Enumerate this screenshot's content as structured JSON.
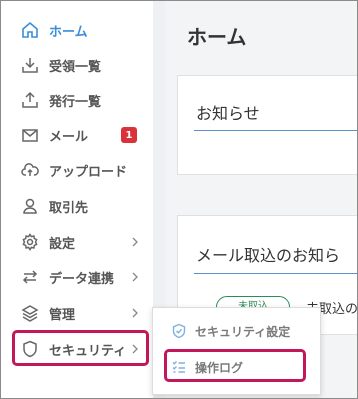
{
  "sidebar": {
    "items": [
      {
        "label": "ホーム",
        "icon": "home-icon"
      },
      {
        "label": "受領一覧",
        "icon": "download-tray-icon"
      },
      {
        "label": "発行一覧",
        "icon": "upload-tray-icon"
      },
      {
        "label": "メール",
        "icon": "envelope-icon",
        "badge": "1"
      },
      {
        "label": "アップロード",
        "icon": "cloud-upload-icon"
      },
      {
        "label": "取引先",
        "icon": "person-icon"
      },
      {
        "label": "設定",
        "icon": "gear-icon"
      },
      {
        "label": "データ連携",
        "icon": "swap-arrows-icon"
      },
      {
        "label": "管理",
        "icon": "layers-icon"
      },
      {
        "label": "セキュリティ",
        "icon": "shield-icon"
      }
    ]
  },
  "main": {
    "title": "ホーム",
    "cards": [
      {
        "title": "お知らせ"
      },
      {
        "title": "メール取込のお知ら",
        "status_pill": "未取込",
        "row_text": "未取込の"
      }
    ]
  },
  "submenu": {
    "items": [
      {
        "label": "セキュリティ設定",
        "icon": "shield-check-icon"
      },
      {
        "label": "操作ログ",
        "icon": "checklist-icon"
      }
    ]
  },
  "colors": {
    "accent": "#3a8dd8",
    "highlight": "#c2185b",
    "badge": "#d9323a",
    "status_green": "#2e8b57"
  }
}
